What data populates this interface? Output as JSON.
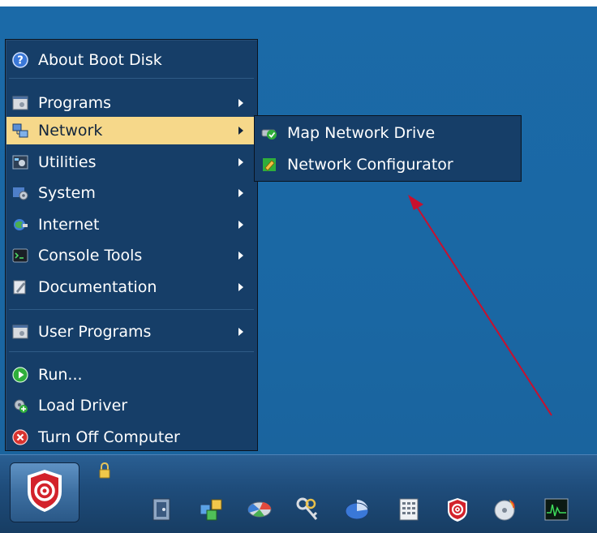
{
  "menu": {
    "items": [
      {
        "label": "About Boot Disk",
        "icon": "help-icon"
      },
      {
        "label": "Programs",
        "icon": "programs-icon",
        "submenu": true
      },
      {
        "label": "Network",
        "icon": "network-icon",
        "submenu": true,
        "active": true
      },
      {
        "label": "Utilities",
        "icon": "utilities-icon",
        "submenu": true
      },
      {
        "label": "System",
        "icon": "system-icon",
        "submenu": true
      },
      {
        "label": "Internet",
        "icon": "internet-icon",
        "submenu": true
      },
      {
        "label": "Console Tools",
        "icon": "console-icon",
        "submenu": true
      },
      {
        "label": "Documentation",
        "icon": "documentation-icon",
        "submenu": true
      },
      {
        "label": "User Programs",
        "icon": "user-programs-icon",
        "submenu": true
      },
      {
        "label": "Run...",
        "icon": "run-icon"
      },
      {
        "label": "Load Driver",
        "icon": "driver-icon"
      },
      {
        "label": "Turn Off Computer",
        "icon": "power-icon"
      }
    ]
  },
  "submenu": {
    "items": [
      {
        "label": "Map Network Drive",
        "icon": "map-drive-icon"
      },
      {
        "label": "Network Configurator",
        "icon": "network-config-icon"
      }
    ]
  },
  "colors": {
    "desktop": "#1b6aa8",
    "menu_bg": "#163e68",
    "highlight": "#f6d88a",
    "annotation": "#c8102e"
  },
  "taskbar": {
    "start_icon": "antivirus-logo-icon",
    "tray_icons": [
      "file-manager-icon",
      "window-switcher-icon",
      "disk-tool-icon",
      "password-keys-icon",
      "partition-icon",
      "calculator-icon",
      "antivirus-icon",
      "cd-burner-icon",
      "monitor-icon"
    ]
  }
}
